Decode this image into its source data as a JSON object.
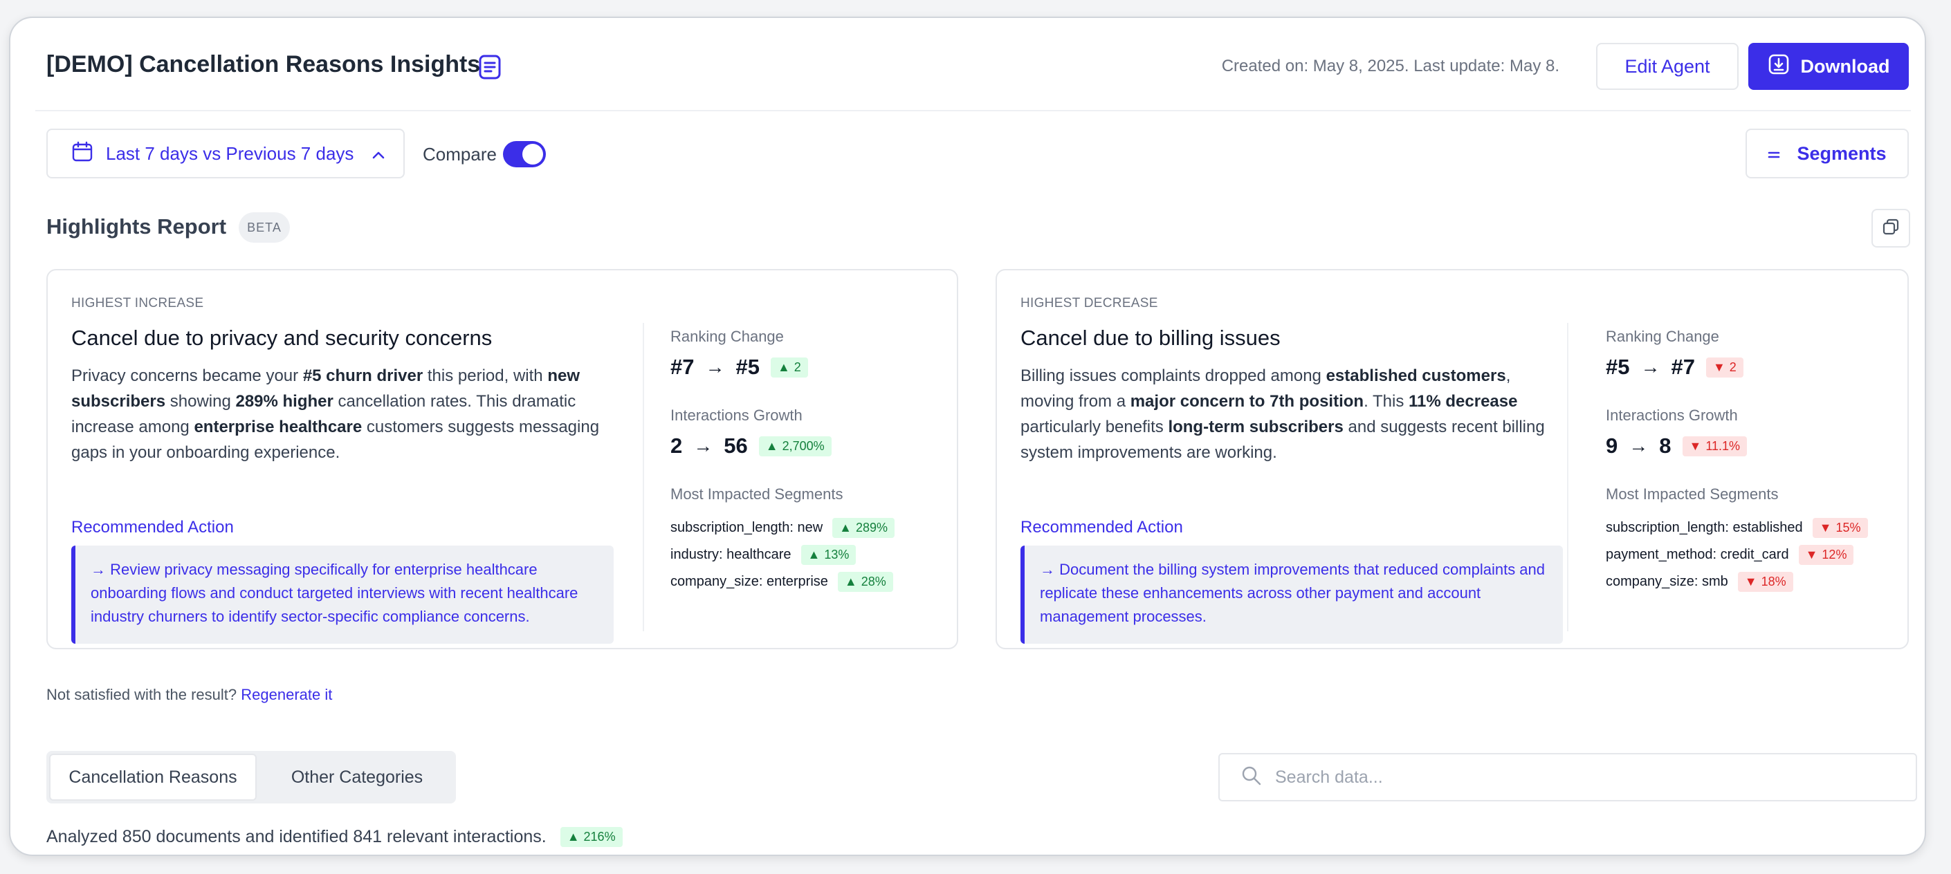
{
  "header": {
    "title": "[DEMO] Cancellation Reasons Insights",
    "title_icon": "document-icon",
    "created_text": "Created on: May 8, 2025.  Last update: May 8.",
    "edit_label": "Edit Agent",
    "download_label": "Download",
    "download_icon": "download-icon"
  },
  "toolbar": {
    "date_range_label": "Last 7 days vs Previous 7 days",
    "date_icon": "calendar-icon",
    "compare_label": "Compare",
    "compare_on": true,
    "segments_label": "Segments",
    "segments_icon": "equals-icon"
  },
  "highlights": {
    "title": "Highlights Report",
    "badge": "BETA",
    "copy_icon": "copy-icon"
  },
  "cards": [
    {
      "kicker": "HIGHEST INCREASE",
      "title": "Cancel due to privacy and security concerns",
      "body_parts": [
        [
          "Privacy concerns became your ",
          false
        ],
        [
          "#5 churn driver",
          true
        ],
        [
          " this period, with ",
          false
        ],
        [
          "new subscribers",
          true
        ],
        [
          " showing ",
          false
        ],
        [
          "289% higher",
          true
        ],
        [
          " cancellation rates. This dramatic increase among ",
          false
        ],
        [
          "enterprise healthcare",
          true
        ],
        [
          " customers suggests messaging gaps in your onboarding experience.",
          false
        ]
      ],
      "recommended_label": "Recommended Action",
      "recommended_text": "→ Review privacy messaging specifically for enterprise healthcare onboarding flows and conduct targeted interviews with recent healthcare industry churners to identify sector-specific compliance concerns.",
      "ranking_label": "Ranking Change",
      "ranking_from": "#7",
      "ranking_to": "#5",
      "ranking_badge": "2",
      "ranking_dir": "up",
      "growth_label": "Interactions Growth",
      "growth_from": "2",
      "growth_to": "56",
      "growth_badge": "2,700%",
      "growth_dir": "up",
      "segments_label": "Most Impacted Segments",
      "segments": [
        {
          "name": "subscription_length: new",
          "value": "289%",
          "dir": "up"
        },
        {
          "name": "industry: healthcare",
          "value": "13%",
          "dir": "up"
        },
        {
          "name": "company_size: enterprise",
          "value": "28%",
          "dir": "up"
        }
      ]
    },
    {
      "kicker": "HIGHEST DECREASE",
      "title": "Cancel due to billing issues",
      "body_parts": [
        [
          "Billing issues complaints dropped among ",
          false
        ],
        [
          "established customers",
          true
        ],
        [
          ", moving from a ",
          false
        ],
        [
          "major concern to 7th position",
          true
        ],
        [
          ". This ",
          false
        ],
        [
          "11% decrease",
          true
        ],
        [
          " particularly benefits ",
          false
        ],
        [
          "long-term subscribers",
          true
        ],
        [
          " and suggests recent billing system improvements are working.",
          false
        ]
      ],
      "recommended_label": "Recommended Action",
      "recommended_text": "→ Document the billing system improvements that reduced complaints and replicate these enhancements across other payment and account management processes.",
      "ranking_label": "Ranking Change",
      "ranking_from": "#5",
      "ranking_to": "#7",
      "ranking_badge": "2",
      "ranking_dir": "down",
      "growth_label": "Interactions Growth",
      "growth_from": "9",
      "growth_to": "8",
      "growth_badge": "11.1%",
      "growth_dir": "down",
      "segments_label": "Most Impacted Segments",
      "segments": [
        {
          "name": "subscription_length: established",
          "value": "15%",
          "dir": "down"
        },
        {
          "name": "payment_method: credit_card",
          "value": "12%",
          "dir": "down"
        },
        {
          "name": "company_size: smb",
          "value": "18%",
          "dir": "down"
        }
      ]
    }
  ],
  "regenerate": {
    "prefix": "Not satisfied with the result?",
    "link": "Regenerate it"
  },
  "tabs": [
    {
      "label": "Cancellation Reasons",
      "active": true
    },
    {
      "label": "Other Categories",
      "active": false
    }
  ],
  "search": {
    "placeholder": "Search data...",
    "icon": "search-icon"
  },
  "summary": {
    "text": "Analyzed 850 documents and identified 841 relevant interactions.",
    "badge": "216%",
    "badge_dir": "up"
  },
  "colors": {
    "accent": "#3b2ee8",
    "up_bg": "#dcfce7",
    "up_fg": "#15803d",
    "down_bg": "#fde2e2",
    "down_fg": "#dc2626"
  }
}
